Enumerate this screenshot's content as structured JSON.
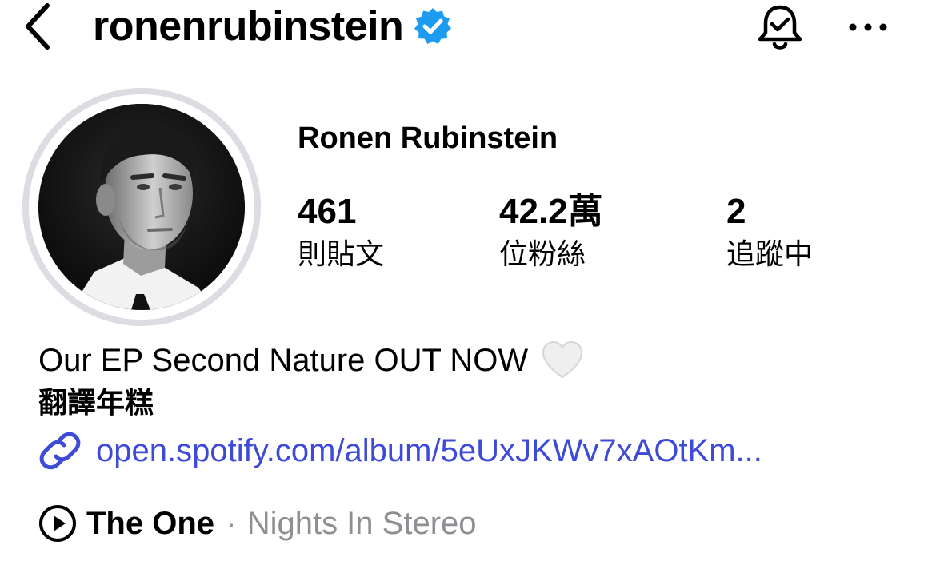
{
  "header": {
    "username": "ronenrubinstein",
    "verified": true,
    "icons": {
      "back": "back-chevron-icon",
      "verified": "verified-badge-icon",
      "bell": "notification-bell-icon",
      "more": "more-options-icon"
    }
  },
  "profile": {
    "display_name": "Ronen Rubinstein",
    "avatar": "profile-photo"
  },
  "stats": [
    {
      "value": "461",
      "label": "則貼文"
    },
    {
      "value": "42.2萬",
      "label": "位粉絲"
    },
    {
      "value": "2",
      "label": "追蹤中"
    }
  ],
  "bio": {
    "line1": "Our EP Second Nature OUT NOW",
    "line1_emoji": "white-heart-icon",
    "line2": "翻譯年糕",
    "link_text": "open.spotify.com/album/5eUxJKWv7xAOtKm...",
    "link_icon": "link-icon"
  },
  "music": {
    "title": "The One",
    "separator": "·",
    "artist": "Nights In Stereo",
    "icon": "play-circle-icon"
  },
  "colors": {
    "background": "#ffffff",
    "text": "#000000",
    "link": "#3d4bd6",
    "verified": "#1d9bf0",
    "muted": "#8e8e93",
    "avatar_ring": "#dbdde2"
  }
}
